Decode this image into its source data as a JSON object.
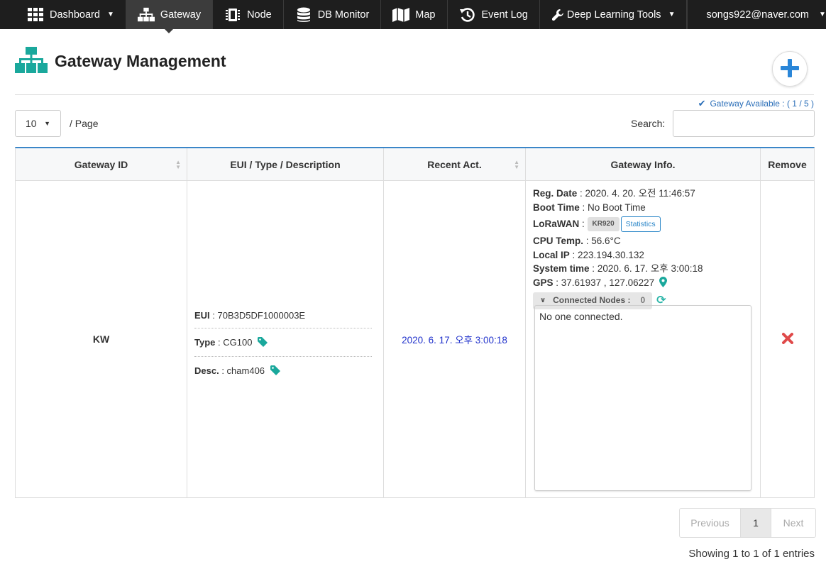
{
  "nav": {
    "items": [
      {
        "label": "Dashboard",
        "icon": "grid-icon",
        "dropdown": true
      },
      {
        "label": "Gateway",
        "icon": "sitemap-icon",
        "active": true
      },
      {
        "label": "Node",
        "icon": "chip-icon"
      },
      {
        "label": "DB Monitor",
        "icon": "database-icon"
      },
      {
        "label": "Map",
        "icon": "map-icon"
      },
      {
        "label": "Event Log",
        "icon": "history-icon"
      },
      {
        "label": "Deep Learning Tools",
        "icon": "wrench-icon",
        "dropdown": true
      }
    ],
    "user": "songs922@naver.com"
  },
  "header": {
    "title": "Gateway Management",
    "available": "Gateway Available : ( 1 / 5 )"
  },
  "controls": {
    "page_length": "10",
    "per_page": "/ Page",
    "search_label": "Search:",
    "search_value": ""
  },
  "table": {
    "headers": [
      "Gateway ID",
      "EUI / Type / Description",
      "Recent Act.",
      "Gateway Info.",
      "Remove"
    ],
    "row": {
      "gateway_id": "KW",
      "eui_label": "EUI",
      "eui": "70B3D5DF1000003E",
      "type_label": "Type",
      "type": "CG100",
      "desc_label": "Desc.",
      "desc": "cham406",
      "recent_act": "2020. 6. 17. 오후 3:00:18",
      "info": {
        "reg_date_label": "Reg. Date",
        "reg_date": "2020. 4. 20. 오전 11:46:57",
        "boot_time_label": "Boot Time",
        "boot_time": "No Boot Time",
        "lorawan_label": "LoRaWAN",
        "lorawan_band": "KR920",
        "statistics_label": "Statistics",
        "cpu_temp_label": "CPU Temp.",
        "cpu_temp": "56.6°C",
        "local_ip_label": "Local IP",
        "local_ip": "223.194.30.132",
        "system_time_label": "System time",
        "system_time": "2020. 6. 17. 오후 3:00:18",
        "gps_label": "GPS",
        "gps": "37.61937 , 127.06227",
        "connected_nodes_label": "Connected Nodes :",
        "connected_nodes_count": "0",
        "connected_message": "No one connected."
      }
    }
  },
  "pagination": {
    "previous": "Previous",
    "page": "1",
    "next": "Next",
    "showing": "Showing 1 to 1 of 1 entries"
  },
  "colors": {
    "accent": "#1aa89c",
    "link": "#2a6eb8",
    "remove": "#e04a4a",
    "navbar": "#1e1e1e"
  }
}
